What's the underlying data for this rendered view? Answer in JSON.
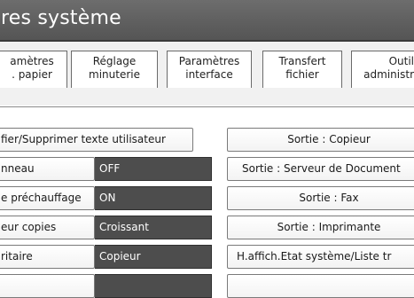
{
  "header": {
    "title": "res système"
  },
  "tabs": [
    {
      "line1": "amètres",
      "line2": ". papier"
    },
    {
      "line1": "Réglage",
      "line2": "minuterie"
    },
    {
      "line1": "Paramètres",
      "line2": "interface"
    },
    {
      "line1": "Transfert",
      "line2": "fichier"
    },
    {
      "line1": "Outil",
      "line2": "administr"
    }
  ],
  "settings": {
    "modify_text": "fier/Supprimer texte utilisateur",
    "rows": [
      {
        "label": "nneau",
        "value": "OFF"
      },
      {
        "label": "e préchauffage",
        "value": "ON"
      },
      {
        "label": "eur copies",
        "value": "Croissant"
      },
      {
        "label": "ritaire",
        "value": "Copieur"
      }
    ]
  },
  "outputs": [
    "Sortie : Copieur",
    "Sortie : Serveur de Document",
    "Sortie : Fax",
    "Sortie : Imprimante",
    "H.affich.Etat système/Liste tr"
  ],
  "colors": {
    "titlebar": "#5e5e5e",
    "value_field": "#4d4d4d",
    "background": "#ffffff"
  }
}
